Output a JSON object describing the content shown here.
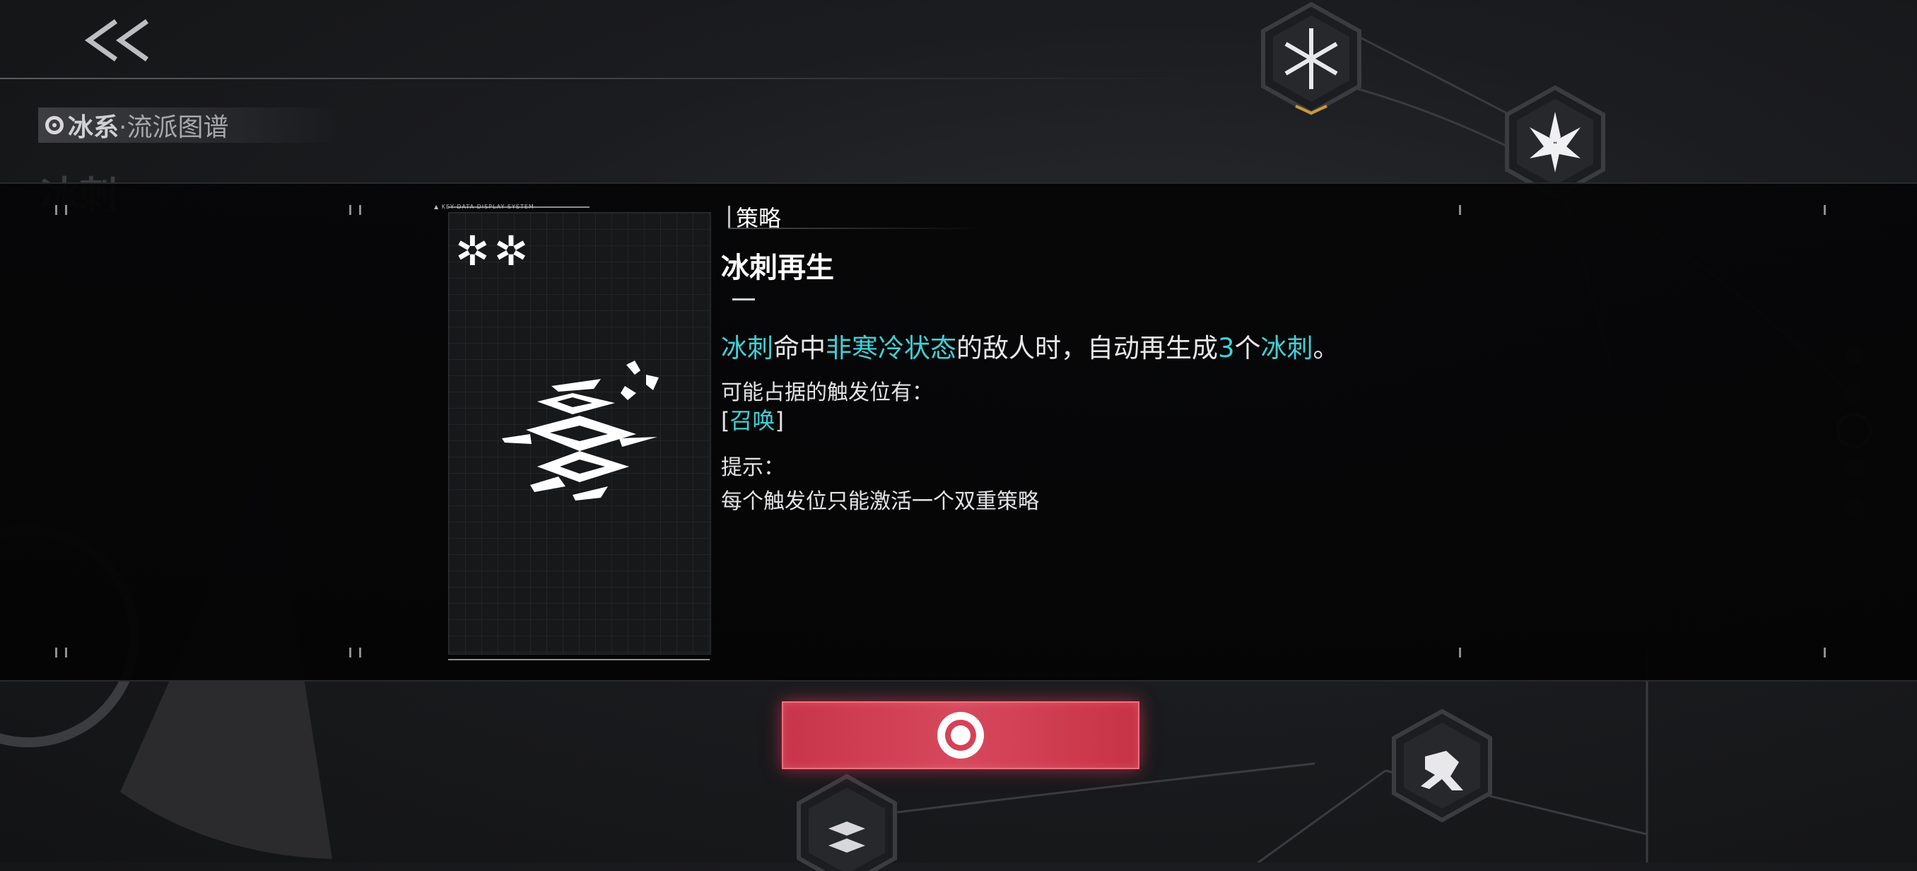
{
  "header": {
    "school_prefix": "冰系",
    "school_suffix": "·流派图谱",
    "background_title": "冰刺"
  },
  "detail": {
    "card_caption": "KEY DATA DISPLAY SYSTEM",
    "card_stars": "✲✲",
    "section_label": "策略",
    "strategy_name": "冰刺再生",
    "description": {
      "part1_hl": "冰刺",
      "part2": "命中",
      "part3_hl": "非寒冷状态",
      "part4": "的敌人时，自动再生成",
      "part5_hl": "3",
      "part6": "个",
      "part7_hl": "冰刺",
      "part8": "。"
    },
    "trigger_label": "可能占据的触发位有：",
    "trigger_open": "[",
    "trigger_value": "召唤",
    "trigger_close": "]",
    "hint_label": "提示：",
    "hint_text": "每个触发位只能激活一个双重策略"
  },
  "colors": {
    "highlight": "#3fd1d6",
    "confirm_button": "#d7485c"
  },
  "icons": {
    "back": "double-chevron-left-icon",
    "confirm": "target-ring-icon",
    "strategy": "ice-spike-regenerate-icon"
  }
}
